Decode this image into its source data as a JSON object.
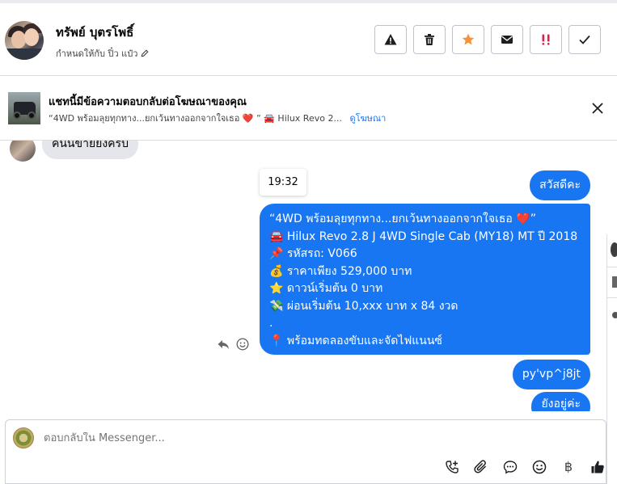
{
  "header": {
    "contact_name": "ทรัพย์ บุตรโพธิ์",
    "assigned_to": "กำหนดให้กับ ปิ๋ว แป๋ว",
    "actions": [
      {
        "name": "report-button",
        "icon": "warning-icon"
      },
      {
        "name": "delete-button",
        "icon": "trash-icon"
      },
      {
        "name": "star-button",
        "icon": "star-icon",
        "color": "#f7923b"
      },
      {
        "name": "mark-unread-button",
        "icon": "envelope-icon"
      },
      {
        "name": "spam-button",
        "icon": "exclamation-icon",
        "color": "#e41e3f"
      },
      {
        "name": "done-button",
        "icon": "check-icon"
      }
    ]
  },
  "ad_banner": {
    "title": "แชทนี้มีข้อความตอบกลับต่อโฆษณาของคุณ",
    "snippet": "“4WD พร้อมลุยทุกทาง...ยกเว้นทางออกจากใจเธอ ❤️ ” 🚘 Hilux Revo 2...",
    "link": "ดูโฆษณา"
  },
  "thread": {
    "incoming": "คนนขายยงครบ",
    "timestamp": "19:32",
    "outgoing": [
      {
        "text": "สวัสดีคะ"
      },
      {
        "lines": [
          "“4WD พร้อมลุยทุกทาง...ยกเว้นทางออกจากใจเธอ ❤️”",
          "🚘 Hilux Revo 2.8 J 4WD Single Cab (MY18) MT ปี 2018",
          "📌 รหัสรถ: V066",
          "💰 ราคาเพียง 529,000 บาท",
          "⭐ ดาวน์เริ่มต้น 0 บาท",
          "💸 ผ่อนเริ่มต้น 10,xxx บาท x 84 งวด",
          ".",
          "📍 พร้อมทดลองขับและจัดไฟแนนซ์"
        ]
      },
      {
        "text": "py'vp^j8jt"
      },
      {
        "text": "ยังอยู่ค่ะ"
      }
    ]
  },
  "composer": {
    "placeholder": "ตอบกลับใน Messenger..."
  },
  "colors": {
    "messenger_blue": "#1876f2",
    "incoming_bubble": "#e4e6eb"
  }
}
